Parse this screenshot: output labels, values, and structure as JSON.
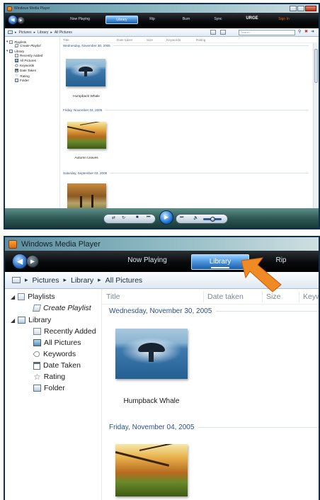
{
  "app": {
    "title": "Windows Media Player"
  },
  "tabs": [
    {
      "label": "Now Playing",
      "active": false
    },
    {
      "label": "Library",
      "active": true
    },
    {
      "label": "Rip",
      "active": false
    },
    {
      "label": "Burn",
      "active": false
    },
    {
      "label": "Sync",
      "active": false
    },
    {
      "label": "URGE",
      "active": false
    },
    {
      "label": "Sign In",
      "active": false
    }
  ],
  "breadcrumb": [
    "Pictures",
    "Library",
    "All Pictures"
  ],
  "search": {
    "placeholder": "Search"
  },
  "sidebar": {
    "playlists": "Playlists",
    "create_playlist": "Create Playlist",
    "library": "Library",
    "items": [
      {
        "label": "Recently Added",
        "icon": "recently-added-icon"
      },
      {
        "label": "All Pictures",
        "icon": "pictures-icon",
        "selected": true
      },
      {
        "label": "Keywords",
        "icon": "tag-icon"
      },
      {
        "label": "Date Taken",
        "icon": "calendar-icon"
      },
      {
        "label": "Rating",
        "icon": "star-icon"
      },
      {
        "label": "Folder",
        "icon": "folder-icon"
      }
    ]
  },
  "columns": [
    "Title",
    "Date taken",
    "Size",
    "Keywords",
    "Rating"
  ],
  "columns_bottom": [
    "Title",
    "Date taken",
    "Size",
    "Keywo"
  ],
  "groups": [
    {
      "date": "Wednesday, November 30, 2005",
      "items": [
        {
          "title": "Humpback Whale"
        }
      ]
    },
    {
      "date": "Friday, November 04, 2005",
      "items": [
        {
          "title": "Autumn Leaves"
        }
      ]
    },
    {
      "date": "Saturday, September 03, 2005",
      "items": [
        {
          "title": ""
        }
      ]
    }
  ],
  "colors": {
    "accent": "#3a7fd0",
    "callout_arrow": "#f08a24",
    "group_header": "#2b4f8c",
    "tab_bar": "#0b0d0f",
    "player_bar": "#2f5a56"
  }
}
